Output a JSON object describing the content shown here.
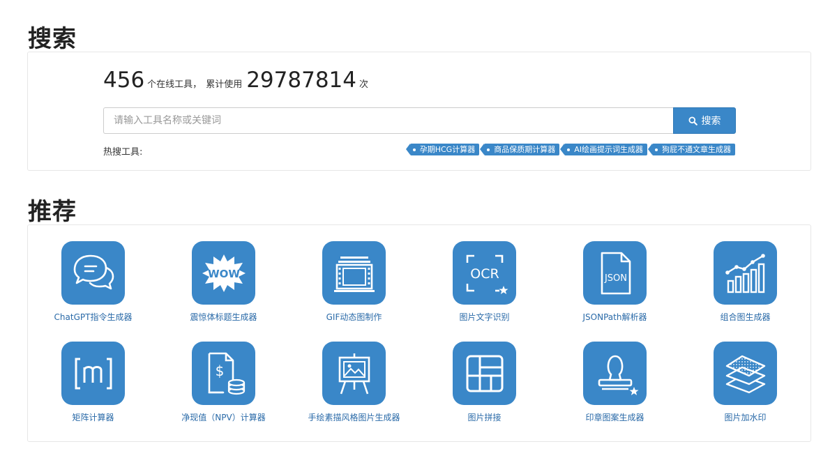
{
  "sections": {
    "search_title": "搜索",
    "recommend_title": "推荐"
  },
  "stats": {
    "tool_count": "456",
    "tool_count_suffix": "个在线工具，",
    "usage_prefix": "累计使用",
    "usage_count": "29787814",
    "usage_suffix": "次"
  },
  "search": {
    "placeholder": "请输入工具名称或关键词",
    "button_label": "搜索"
  },
  "hot": {
    "label": "热搜工具:",
    "tags": [
      "孕期HCG计算器",
      "商品保质期计算器",
      "AI绘画提示词生成器",
      "狗屁不通文章生成器"
    ]
  },
  "tools": [
    {
      "label": "ChatGPT指令生成器",
      "icon": "chat-bubbles-icon"
    },
    {
      "label": "震惊体标题生成器",
      "icon": "wow-icon"
    },
    {
      "label": "GIF动态图制作",
      "icon": "film-frame-icon"
    },
    {
      "label": "图片文字识别",
      "icon": "ocr-icon"
    },
    {
      "label": "JSONPath解析器",
      "icon": "json-file-icon"
    },
    {
      "label": "组合图生成器",
      "icon": "bar-line-chart-icon"
    },
    {
      "label": "矩阵计算器",
      "icon": "matrix-icon"
    },
    {
      "label": "净现值（NPV）计算器",
      "icon": "dollar-coins-icon"
    },
    {
      "label": "手绘素描风格图片生成器",
      "icon": "easel-icon"
    },
    {
      "label": "图片拼接",
      "icon": "image-grid-icon"
    },
    {
      "label": "印章图案生成器",
      "icon": "stamp-icon"
    },
    {
      "label": "图片加水印",
      "icon": "layers-icon"
    }
  ],
  "colors": {
    "accent": "#3a87c8",
    "link": "#2a6aa8"
  }
}
